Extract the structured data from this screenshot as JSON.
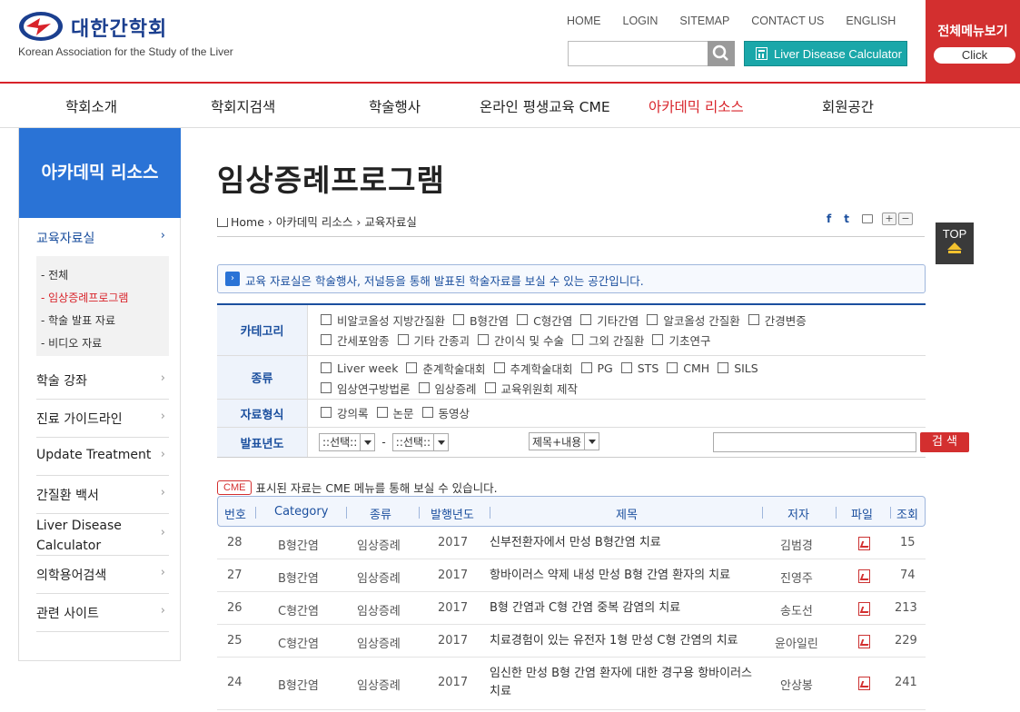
{
  "header": {
    "logo_ko": "대한간학회",
    "logo_en": "Korean Association for the Study of the Liver",
    "topnav": [
      "HOME",
      "LOGIN",
      "SITEMAP",
      "CONTACT US",
      "ENGLISH"
    ],
    "calculator_label": "Liver Disease Calculator",
    "allmenu_title": "전체메뉴보기",
    "allmenu_click": "Click",
    "brand_color": "#d8232a",
    "accent_color": "#1aa7a9"
  },
  "gnb": [
    "학회소개",
    "학회지검색",
    "학술행사",
    "온라인 평생교육 CME",
    "아카데믹 리소스",
    "회원공간"
  ],
  "sidebar": {
    "title": "아카데믹 리소스",
    "current": "교육자료실",
    "sub": [
      "- 전체",
      "- 임상증례프로그램",
      "- 학술 발표 자료",
      "- 비디오 자료"
    ],
    "items": [
      "학술 강좌",
      "진료 가이드라인",
      "Update Treatment",
      "간질환 백서",
      "Liver Disease Calculator",
      "의학용어검색",
      "관련 사이트"
    ]
  },
  "content": {
    "page_title": "임상증례프로그램",
    "breadcrumb": [
      "Home",
      "아카데믹 리소스",
      "교육자료실"
    ],
    "tools": {
      "facebook": "f",
      "twitter": "t",
      "zoom_in": "+",
      "zoom_out": "−"
    },
    "top_label": "TOP",
    "notice": "교육 자료실은 학술행사, 저널등을 통해 발표된 학술자료를 보실 수 있는 공간입니다."
  },
  "search": {
    "category_label": "카테고리",
    "categories_row1": [
      "비알코올성 지방간질환",
      "B형간염",
      "C형간염",
      "기타간염",
      "알코올성 간질환",
      "간경변증"
    ],
    "categories_row2": [
      "간세포암종",
      "기타 간종괴",
      "간이식 및 수술",
      "그외 간질환",
      "기초연구"
    ],
    "type_label": "종류",
    "types_row1": [
      "Liver week",
      "춘계학술대회",
      "추계학술대회",
      "PG",
      "STS",
      "CMH",
      "SILS"
    ],
    "types_row2": [
      "임상연구방법론",
      "임상증례",
      "교육위원회 제작"
    ],
    "format_label": "자료형식",
    "formats": [
      "강의록",
      "논문",
      "동영상"
    ],
    "year_label": "발표년도",
    "year_from": "::선택::",
    "year_dash": "-",
    "year_to": "::선택::",
    "field_select": "제목+내용",
    "submit": "검 색"
  },
  "list": {
    "cme_badge": "CME",
    "cme_note": "표시된 자료는 CME 메뉴를 통해 보실 수 있습니다.",
    "columns": [
      "번호",
      "Category",
      "종류",
      "발행년도",
      "제목",
      "저자",
      "파일",
      "조회"
    ],
    "rows": [
      {
        "no": "28",
        "category": "B형간염",
        "type": "임상증례",
        "year": "2017",
        "title": "신부전환자에서 만성 B형간염 치료",
        "author": "김범경",
        "views": "15"
      },
      {
        "no": "27",
        "category": "B형간염",
        "type": "임상증례",
        "year": "2017",
        "title": "항바이러스 약제 내성 만성 B형 간염 환자의 치료",
        "author": "진영주",
        "views": "74"
      },
      {
        "no": "26",
        "category": "C형간염",
        "type": "임상증례",
        "year": "2017",
        "title": "B형 간염과 C형 간염 중복 감염의 치료",
        "author": "송도선",
        "views": "213"
      },
      {
        "no": "25",
        "category": "C형간염",
        "type": "임상증례",
        "year": "2017",
        "title": "치료경험이 있는 유전자 1형 만성 C형 간염의 치료",
        "author": "윤아일린",
        "views": "229"
      },
      {
        "no": "24",
        "category": "B형간염",
        "type": "임상증례",
        "year": "2017",
        "title": "임신한 만성 B형 간염 환자에 대한 경구용 항바이러스 치료",
        "author": "안상봉",
        "views": "241"
      }
    ]
  }
}
